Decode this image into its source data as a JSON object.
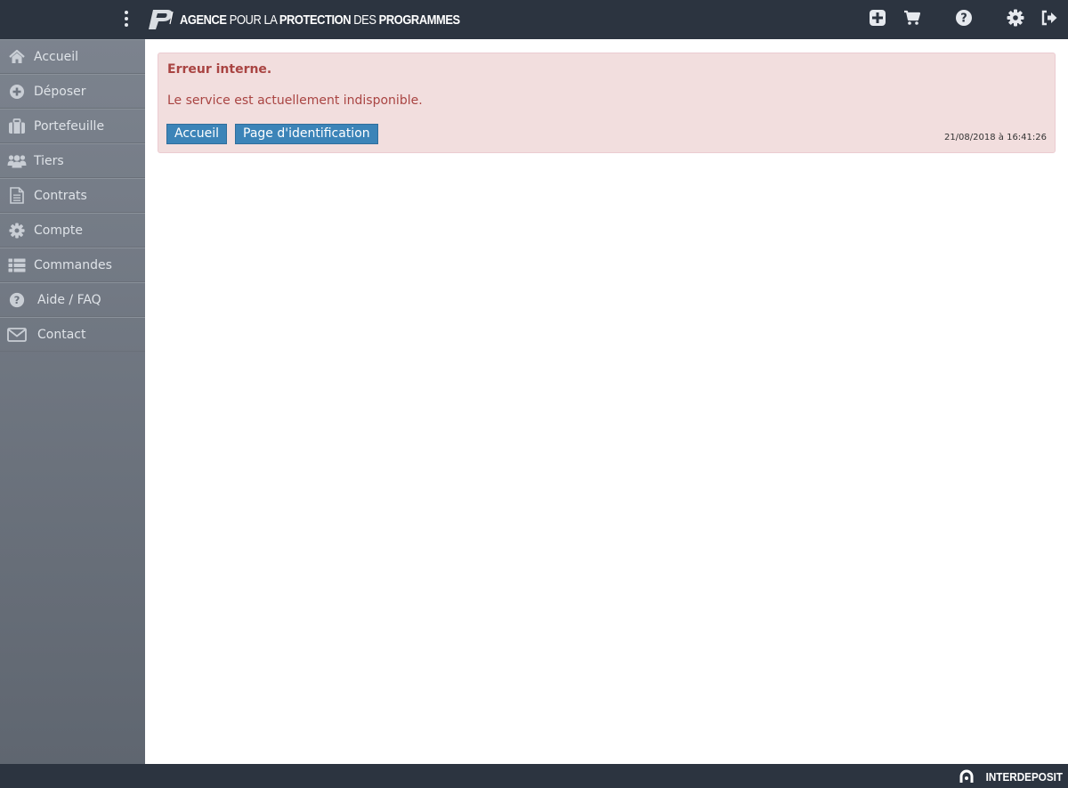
{
  "header": {
    "logo": {
      "w1": "AGENCE",
      "w2": " POUR LA ",
      "w3": "PROTECTION",
      "w4": " DES ",
      "w5": "PROGRAMMES"
    },
    "icons": [
      "plus-square-icon",
      "cart-icon",
      "question-icon",
      "gear-icon",
      "logout-icon"
    ]
  },
  "sidebar": {
    "items": [
      {
        "label": "Accueil",
        "icon": "home-icon"
      },
      {
        "label": "Déposer",
        "icon": "plus-circle-icon"
      },
      {
        "label": "Portefeuille",
        "icon": "briefcase-icon"
      },
      {
        "label": "Tiers",
        "icon": "users-icon"
      },
      {
        "label": "Contrats",
        "icon": "document-icon"
      },
      {
        "label": "Compte",
        "icon": "gear-icon"
      },
      {
        "label": "Commandes",
        "icon": "list-icon"
      },
      {
        "label": "Aide / FAQ",
        "icon": "question-icon"
      },
      {
        "label": "Contact",
        "icon": "envelope-icon"
      }
    ]
  },
  "alert": {
    "title": "Erreur interne.",
    "message": "Le service est actuellement indisponible.",
    "home_button": "Accueil",
    "login_button": "Page d'identification",
    "timestamp": "21/08/2018 à 16:41:26"
  },
  "footer": {
    "brand": "INTERDEPOSIT"
  },
  "colors": {
    "topbar": "#2c3440",
    "sidebar_top": "#7c838e",
    "sidebar_bottom": "#5f6670",
    "alert_bg": "#f2dede",
    "alert_text": "#a94442",
    "button": "#3c84b8"
  }
}
